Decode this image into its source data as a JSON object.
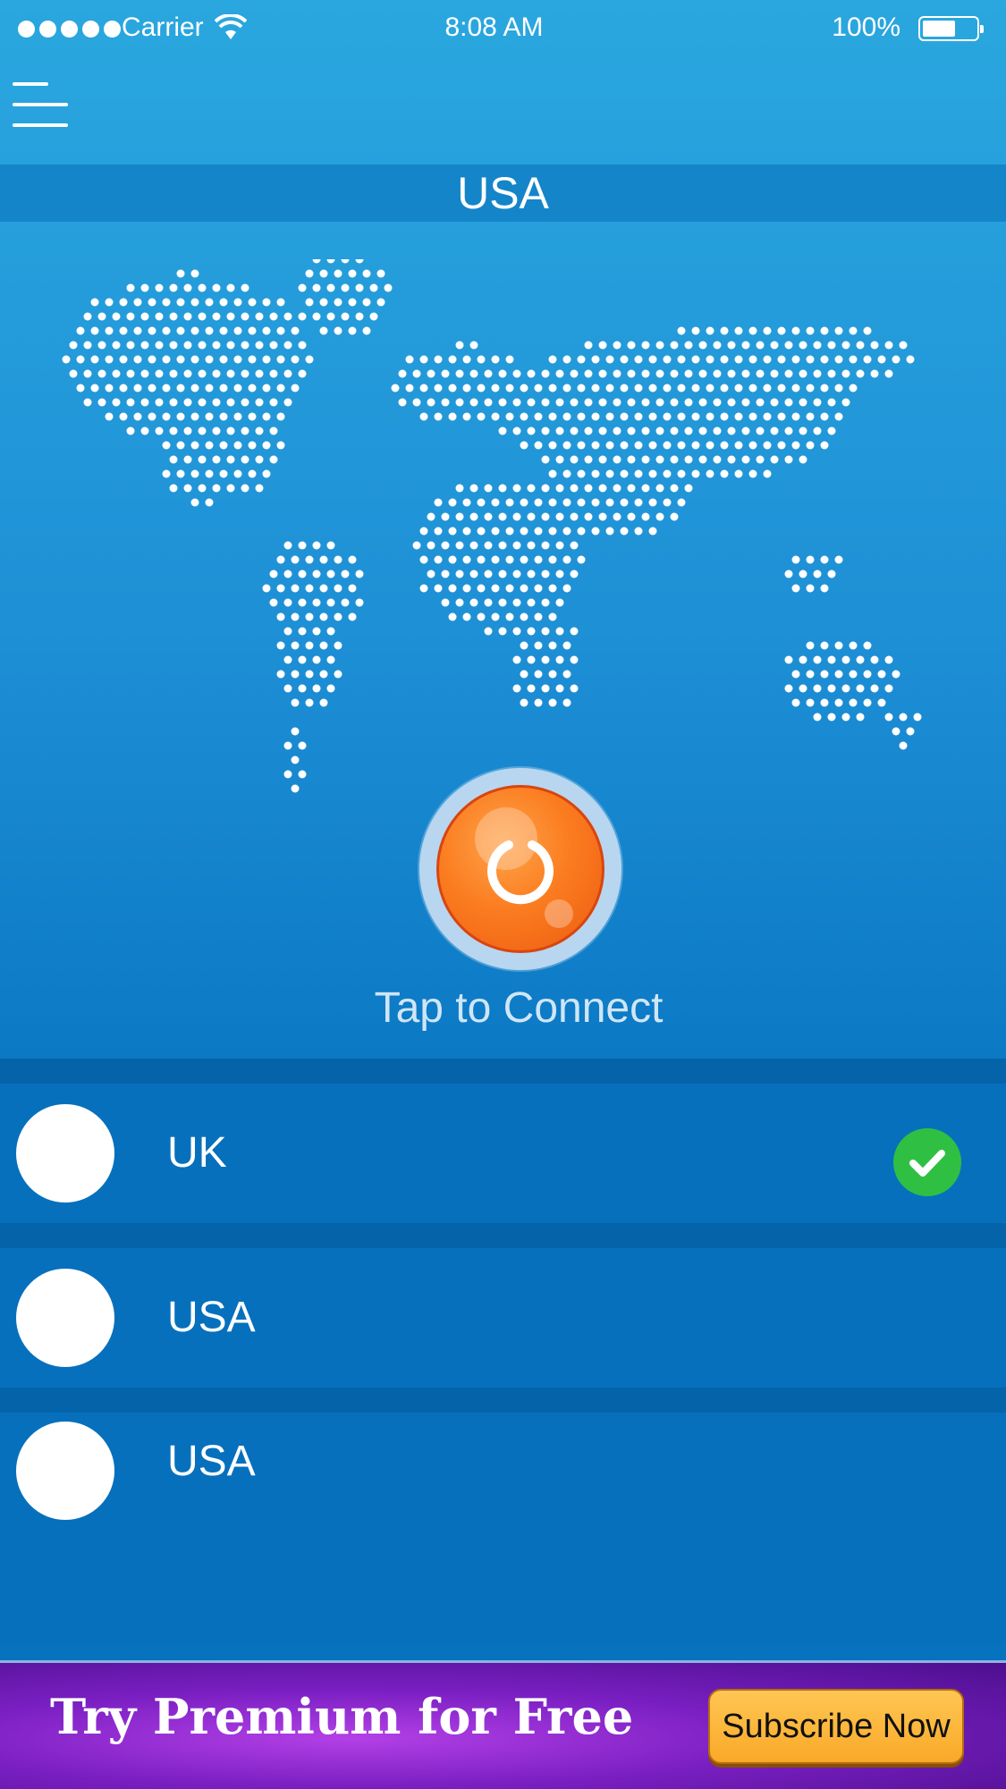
{
  "status_bar": {
    "carrier": "Carrier",
    "time": "8:08 AM",
    "battery": "100%"
  },
  "header": {
    "menu_icon": "hamburger-menu-icon",
    "location": "USA"
  },
  "connect": {
    "label": "Tap to Connect",
    "icon": "power-icon"
  },
  "servers": [
    {
      "name": "UK",
      "selected": true
    },
    {
      "name": "USA",
      "selected": false
    },
    {
      "name": "USA",
      "selected": false
    }
  ],
  "banner": {
    "title": "Try Premium for Free",
    "button_label": "Subscribe Now"
  },
  "colors": {
    "background": "#0670bd",
    "accent_orange": "#fb7d20",
    "check_green": "#2fc043",
    "banner_purple": "#7a1fc2",
    "button_gold": "#f9a928"
  }
}
